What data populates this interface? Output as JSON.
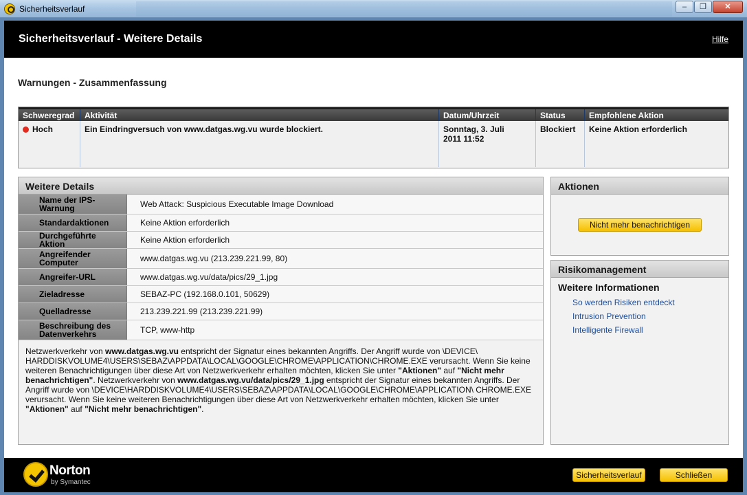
{
  "window": {
    "title": "Sicherheitsverlauf",
    "close_glyph": "✕",
    "min_glyph": "–",
    "max_glyph": "❐"
  },
  "header": {
    "title": "Sicherheitsverlauf - Weitere Details",
    "help": "Hilfe"
  },
  "summary": {
    "title": "Warnungen - Zusammenfassung",
    "columns": [
      "Schweregrad",
      "Aktivität",
      "Datum/Uhrzeit",
      "Status",
      "Empfohlene Aktion"
    ],
    "row": {
      "severity": "Hoch",
      "activity": "Ein Eindringversuch von www.datgas.wg.vu wurde blockiert.",
      "datetime_line1": "Sonntag, 3. Juli",
      "datetime_line2": "2011 11:52",
      "status": "Blockiert",
      "recommended": "Keine Aktion erforderlich"
    },
    "severity_color": "#e32a1f"
  },
  "details": {
    "title": "Weitere Details",
    "rows": [
      {
        "label": "Name der IPS-Warnung",
        "value": "Web Attack: Suspicious Executable Image Download"
      },
      {
        "label": "Standardaktionen",
        "value": "Keine Aktion erforderlich"
      },
      {
        "label": "Durchgeführte Aktion",
        "value": "Keine Aktion erforderlich"
      },
      {
        "label": "Angreifender Computer",
        "value": "www.datgas.wg.vu (213.239.221.99, 80)"
      },
      {
        "label": "Angreifer-URL",
        "value": "www.datgas.wg.vu/data/pics/29_1.jpg"
      },
      {
        "label": "Zieladresse",
        "value": "SEBAZ-PC (192.168.0.101, 50629)"
      },
      {
        "label": "Quelladresse",
        "value": "213.239.221.99 (213.239.221.99)"
      },
      {
        "label": "Beschreibung des Datenverkehrs",
        "value": "TCP, www-http"
      }
    ],
    "description": {
      "p1": "Netzwerkverkehr von ",
      "b1": "www.datgas.wg.vu",
      "p2": " entspricht der Signatur eines bekannten Angriffs. Der Angriff wurde von \\DEVICE\\ HARDDISKVOLUME4\\USERS\\SEBAZ\\APPDATA\\LOCAL\\GOOGLE\\CHROME\\APPLICATION\\CHROME.EXE verursacht. Wenn Sie keine weiteren Benachrichtigungen über diese Art von Netzwerkverkehr erhalten möchten, klicken Sie unter ",
      "b2": "\"Aktionen\"",
      "p3": " auf ",
      "b3": "\"Nicht mehr benachrichtigen\"",
      "p4": ". Netzwerkverkehr von ",
      "b4": "www.datgas.wg.vu/data/pics/29_1.jpg",
      "p5": " entspricht der Signatur eines bekannten Angriffs. Der Angriff wurde von \\DEVICE\\HARDDISKVOLUME4\\USERS\\SEBAZ\\APPDATA\\LOCAL\\GOOGLE\\CHROME\\APPLICATION\\ CHROME.EXE verursacht. Wenn Sie keine weiteren Benachrichtigungen über diese Art von Netzwerkverkehr erhalten möchten, klicken Sie unter ",
      "b5": "\"Aktionen\"",
      "p6": " auf ",
      "b6": "\"Nicht mehr benachrichtigen\"",
      "p7": "."
    }
  },
  "actions": {
    "title": "Aktionen",
    "button": "Nicht mehr benachrichtigen"
  },
  "risk": {
    "title": "Risikomanagement",
    "subtitle": "Weitere Informationen",
    "links": [
      "So werden Risiken entdeckt",
      "Intrusion Prevention",
      "Intelligente Firewall"
    ]
  },
  "footer": {
    "brand": "Norton",
    "brand_sub": "by Symantec",
    "history_button": "Sicherheitsverlauf",
    "close_button": "Schließen"
  }
}
